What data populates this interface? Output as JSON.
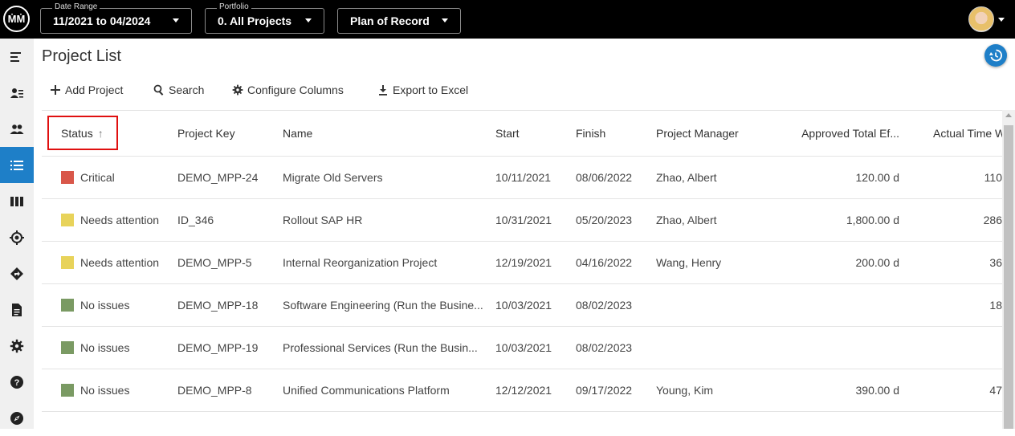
{
  "header": {
    "logo_text": "ṀṀ",
    "date_range": {
      "caption": "Date Range",
      "value": "11/2021 to 04/2024"
    },
    "portfolio": {
      "caption": "Portfolio",
      "value": "0. All Projects"
    },
    "plan": {
      "value": "Plan of Record"
    }
  },
  "sidebar": {
    "items": [
      {
        "icon": "collapse-menu-icon"
      },
      {
        "icon": "user-list-icon"
      },
      {
        "icon": "people-icon"
      },
      {
        "icon": "list-icon",
        "active": true
      },
      {
        "icon": "columns-icon"
      },
      {
        "icon": "target-icon"
      },
      {
        "icon": "directions-icon"
      },
      {
        "icon": "document-icon"
      },
      {
        "icon": "gear-icon"
      },
      {
        "icon": "help-icon"
      },
      {
        "icon": "compass-icon"
      }
    ]
  },
  "page": {
    "title": "Project List"
  },
  "toolbar": {
    "add_label": "Add Project",
    "search_label": "Search",
    "configure_label": "Configure Columns",
    "export_label": "Export to Excel"
  },
  "table": {
    "columns": [
      "Status",
      "Project Key",
      "Name",
      "Start",
      "Finish",
      "Project Manager",
      "Approved Total Ef...",
      "Actual Time W"
    ],
    "rows": [
      {
        "status": "Critical",
        "color": "#d9574a",
        "key": "DEMO_MPP-24",
        "name": "Migrate Old Servers",
        "start": "10/11/2021",
        "finish": "08/06/2022",
        "manager": "Zhao, Albert",
        "approved": "120.00 d",
        "actual": "110"
      },
      {
        "status": "Needs attention",
        "color": "#e8d35a",
        "key": "ID_346",
        "name": "Rollout SAP HR",
        "start": "10/31/2021",
        "finish": "05/20/2023",
        "manager": "Zhao, Albert",
        "approved": "1,800.00 d",
        "actual": "286"
      },
      {
        "status": "Needs attention",
        "color": "#e8d35a",
        "key": "DEMO_MPP-5",
        "name": "Internal Reorganization Project",
        "start": "12/19/2021",
        "finish": "04/16/2022",
        "manager": "Wang, Henry",
        "approved": "200.00 d",
        "actual": "36"
      },
      {
        "status": "No issues",
        "color": "#7a9a63",
        "key": "DEMO_MPP-18",
        "name": "Software Engineering (Run the Busine...",
        "start": "10/03/2021",
        "finish": "08/02/2023",
        "manager": "",
        "approved": "",
        "actual": "18"
      },
      {
        "status": "No issues",
        "color": "#7a9a63",
        "key": "DEMO_MPP-19",
        "name": "Professional Services (Run the Busin...",
        "start": "10/03/2021",
        "finish": "08/02/2023",
        "manager": "",
        "approved": "",
        "actual": ""
      },
      {
        "status": "No issues",
        "color": "#7a9a63",
        "key": "DEMO_MPP-8",
        "name": "Unified Communications Platform",
        "start": "12/12/2021",
        "finish": "09/17/2022",
        "manager": "Young, Kim",
        "approved": "390.00 d",
        "actual": "47"
      }
    ]
  },
  "colors": {
    "accent": "#1e7fc8",
    "highlight": "#e01010"
  }
}
